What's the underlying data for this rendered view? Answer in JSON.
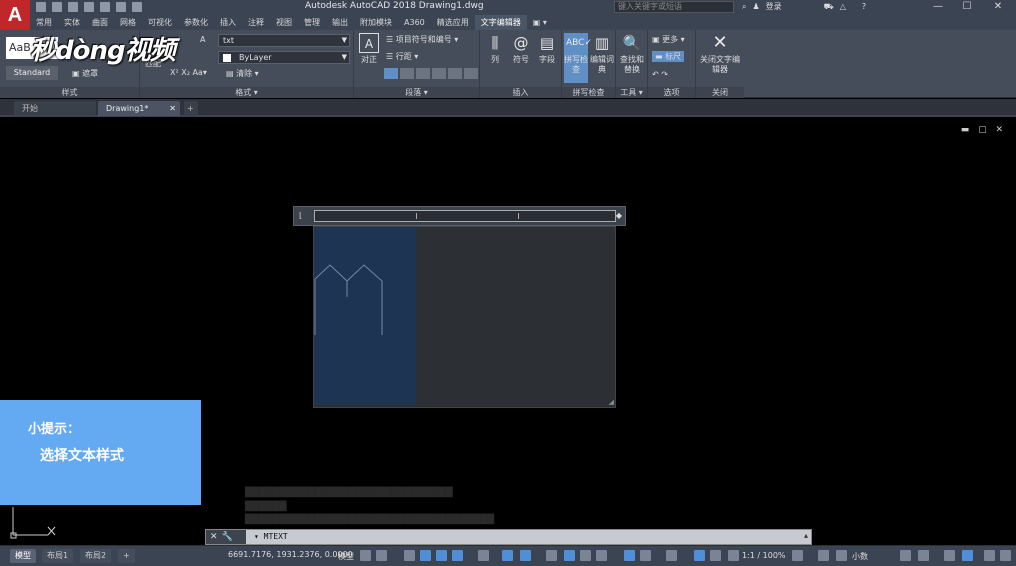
{
  "titlebar": {
    "logo_letter": "A",
    "title": "Autodesk AutoCAD 2018    Drawing1.dwg",
    "search_placeholder": "键入关键字或短语",
    "login_label": "登录",
    "minimize": "—",
    "maximize": "☐",
    "close": "✕"
  },
  "ribbon_tabs": [
    "常用",
    "实体",
    "曲面",
    "网格",
    "可视化",
    "参数化",
    "插入",
    "注释",
    "视图",
    "管理",
    "输出",
    "附加模块",
    "A360",
    "精选应用",
    "文字编辑器",
    "▣ ▾"
  ],
  "ribbon": {
    "style_panel": {
      "title": "样式",
      "preview": "AaB",
      "style_name": "Standard",
      "mask_label": "遮罩",
      "match_label": "匹配"
    },
    "format_panel": {
      "title": "格式 ▾",
      "font_value": "txt",
      "color_value": "ByLayer",
      "clear_label": "清除 ▾"
    },
    "paragraph_panel": {
      "title": "段落 ▾",
      "justify_label": "对正",
      "bullets_label": "项目符号和编号 ▾",
      "line_spacing_label": "行距 ▾"
    },
    "insert_panel": {
      "title": "插入",
      "columns_label": "列",
      "symbol_label": "符号",
      "field_label": "字段"
    },
    "spell_panel": {
      "title": "拼写检查",
      "spell_label": "拼写检查",
      "dict_label": "编辑词典"
    },
    "tools_panel": {
      "title": "工具 ▾",
      "find_label": "查找和替换"
    },
    "options_panel": {
      "title": "选项",
      "more_label": "更多 ▾",
      "ruler_label": "标尺"
    },
    "close_panel": {
      "title": "关闭",
      "close_label": "关闭文字编辑器"
    }
  },
  "watermark": "秒dòng视频",
  "file_tabs": [
    {
      "label": "开始"
    },
    {
      "label": "Drawing1*"
    }
  ],
  "viewport_controls": "▬ ▢ ✕",
  "tip": {
    "title": "小提示：",
    "body": "选择文本样式"
  },
  "command": {
    "text": "▾ MTEXT",
    "expand": "▴"
  },
  "status": {
    "model_tab": "模型",
    "layout1_tab": "布局1",
    "layout2_tab": "布局2",
    "add_tab": "+",
    "coords": "6691.7176, 1931.2376, 0.0000",
    "model_label": "模型",
    "scale": "1:1 / 100%",
    "units": "小数"
  }
}
